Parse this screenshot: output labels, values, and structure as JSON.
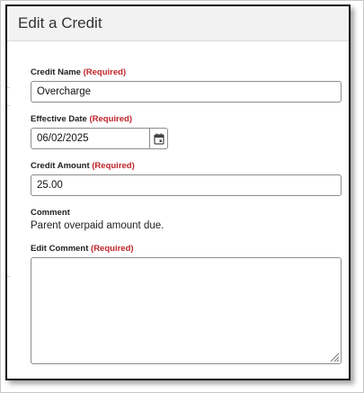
{
  "dialog": {
    "title": "Edit a Credit"
  },
  "form": {
    "credit_name": {
      "label": "Credit Name",
      "required": "(Required)",
      "value": "Overcharge"
    },
    "effective_date": {
      "label": "Effective Date",
      "required": "(Required)",
      "value": "06/02/2025"
    },
    "credit_amount": {
      "label": "Credit Amount",
      "required": "(Required)",
      "value": "25.00"
    },
    "comment": {
      "label": "Comment",
      "value": "Parent overpaid amount due."
    },
    "edit_comment": {
      "label": "Edit Comment",
      "required": "(Required)",
      "value": ""
    }
  },
  "colors": {
    "required": "#c0252a",
    "header_bg": "#f2f2f2"
  },
  "icons": {
    "calendar": "calendar-icon",
    "resize": "resize-handle-icon"
  }
}
